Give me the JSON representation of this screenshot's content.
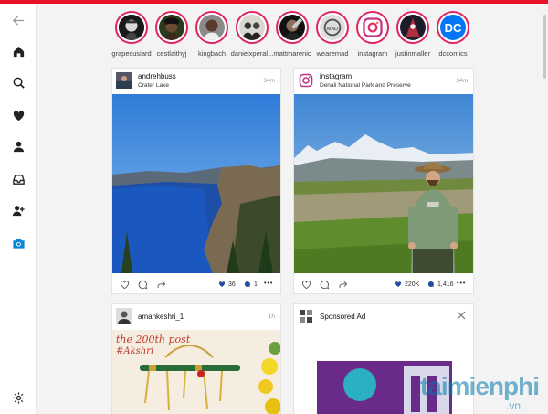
{
  "stories": [
    {
      "username": "grapecusiard"
    },
    {
      "username": "cestlaithyj"
    },
    {
      "username": "kingbach"
    },
    {
      "username": "danielxperal..."
    },
    {
      "username": "mattmarenic"
    },
    {
      "username": "wearemad"
    },
    {
      "username": "instagram"
    },
    {
      "username": "justinmaller"
    },
    {
      "username": "dccomics",
      "avatar_text": "DC"
    }
  ],
  "posts": [
    {
      "username": "andrehbuss",
      "location": "Crater Lake",
      "time": "34m",
      "likes": "36",
      "comments": "1"
    },
    {
      "username": "instagram",
      "location": "Denali National Park and Preserve",
      "time": "34m",
      "likes": "220K",
      "comments": "1,416"
    },
    {
      "username": "amankeshri_1",
      "time": "1h",
      "image_text_line1": "the 200th post",
      "image_text_line2": "#Akshri"
    },
    {
      "username": "Sponsored Ad"
    }
  ],
  "watermark": {
    "main": "taimienphi",
    "sub": ".vn"
  },
  "colors": {
    "accent": "#e81123",
    "story_ring": "#e0245e",
    "sidebar_active": "#0a84d6",
    "like": "#1f4e9e"
  }
}
